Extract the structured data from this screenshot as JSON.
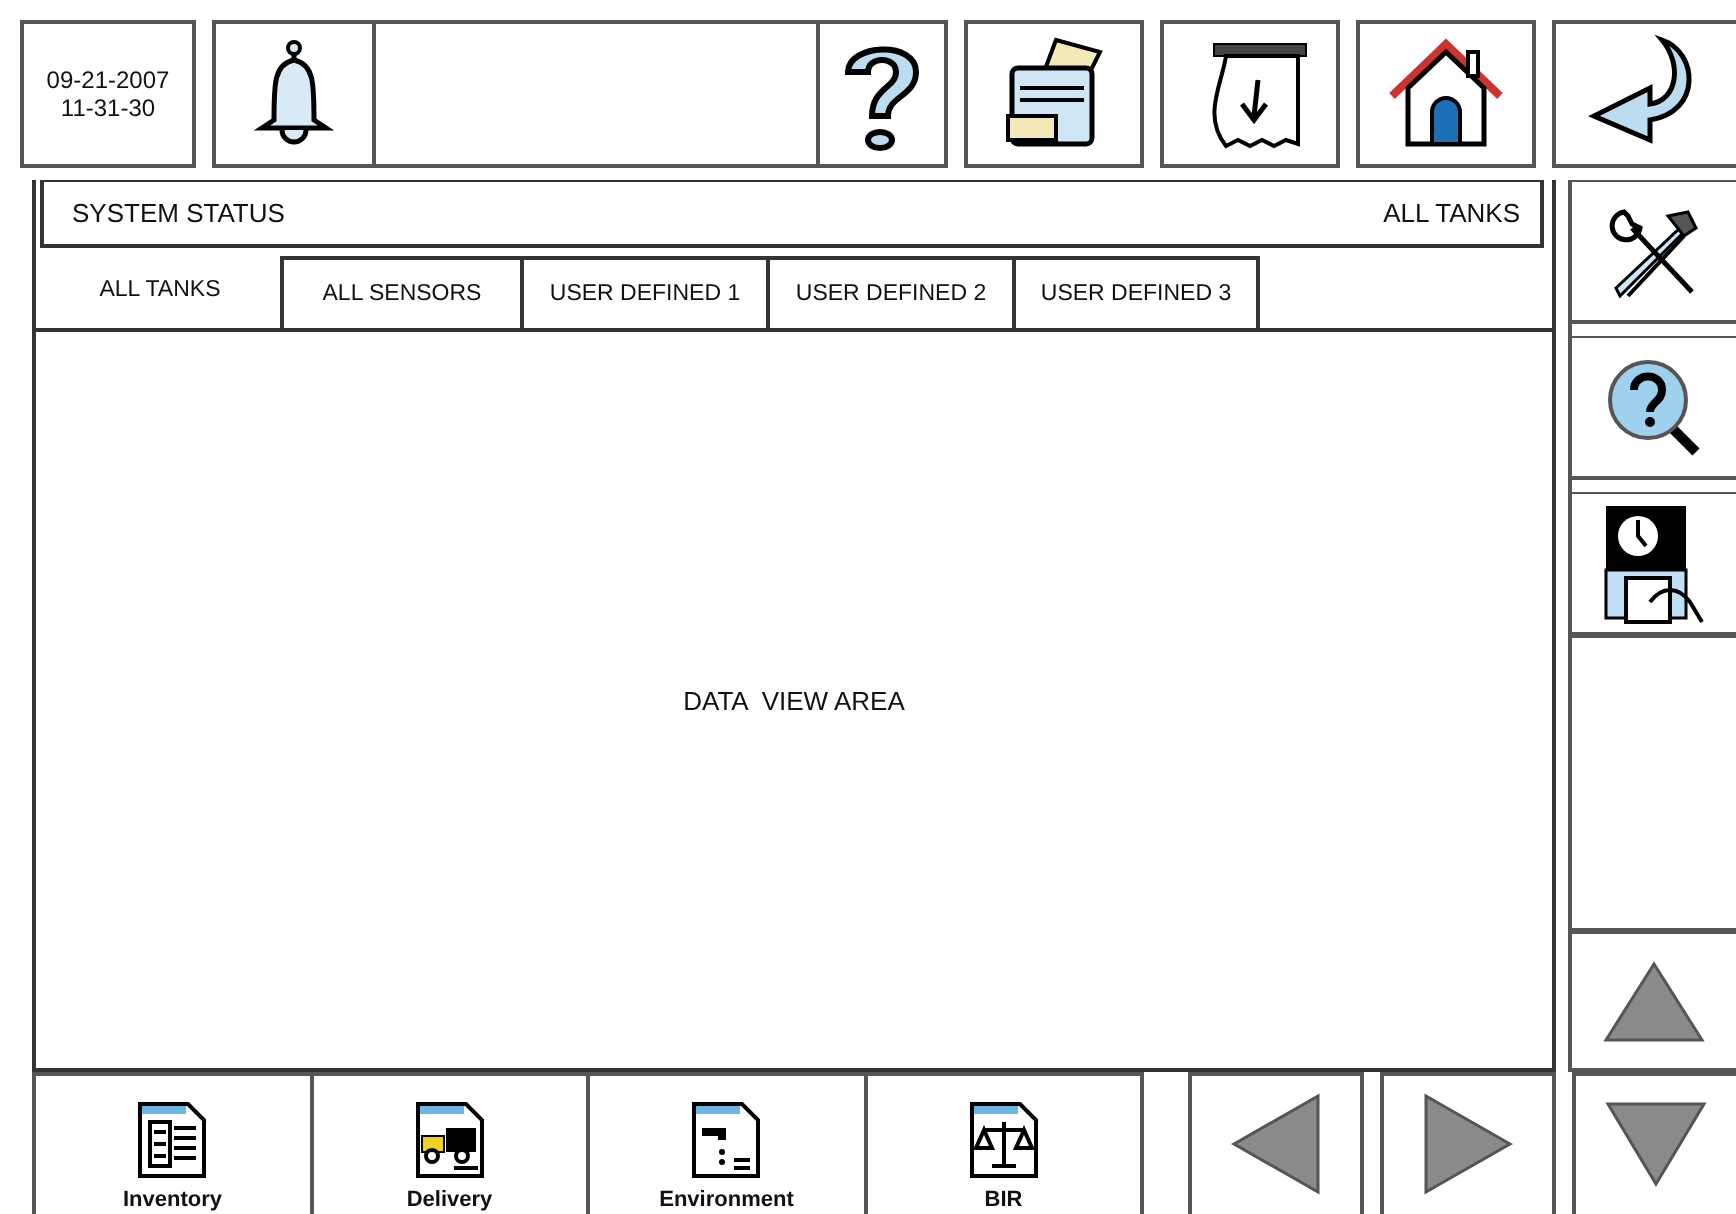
{
  "top_bar": {
    "date": "09-21-2007",
    "time": "11-31-30"
  },
  "header": {
    "title": "SYSTEM STATUS",
    "view": "ALL TANKS"
  },
  "tabs": [
    {
      "label": "ALL TANKS",
      "selected": true
    },
    {
      "label": "ALL SENSORS",
      "selected": false
    },
    {
      "label": "USER DEFINED 1",
      "selected": false
    },
    {
      "label": "USER DEFINED 2",
      "selected": false
    },
    {
      "label": "USER DEFINED 3",
      "selected": false
    }
  ],
  "data_area": {
    "text": "DATA  VIEW AREA"
  },
  "bottom_buttons": [
    {
      "label": "Inventory",
      "kind": "inventory"
    },
    {
      "label": "Delivery",
      "kind": "delivery"
    },
    {
      "label": "Environment",
      "kind": "environment"
    },
    {
      "label": "BIR",
      "kind": "bir"
    }
  ]
}
